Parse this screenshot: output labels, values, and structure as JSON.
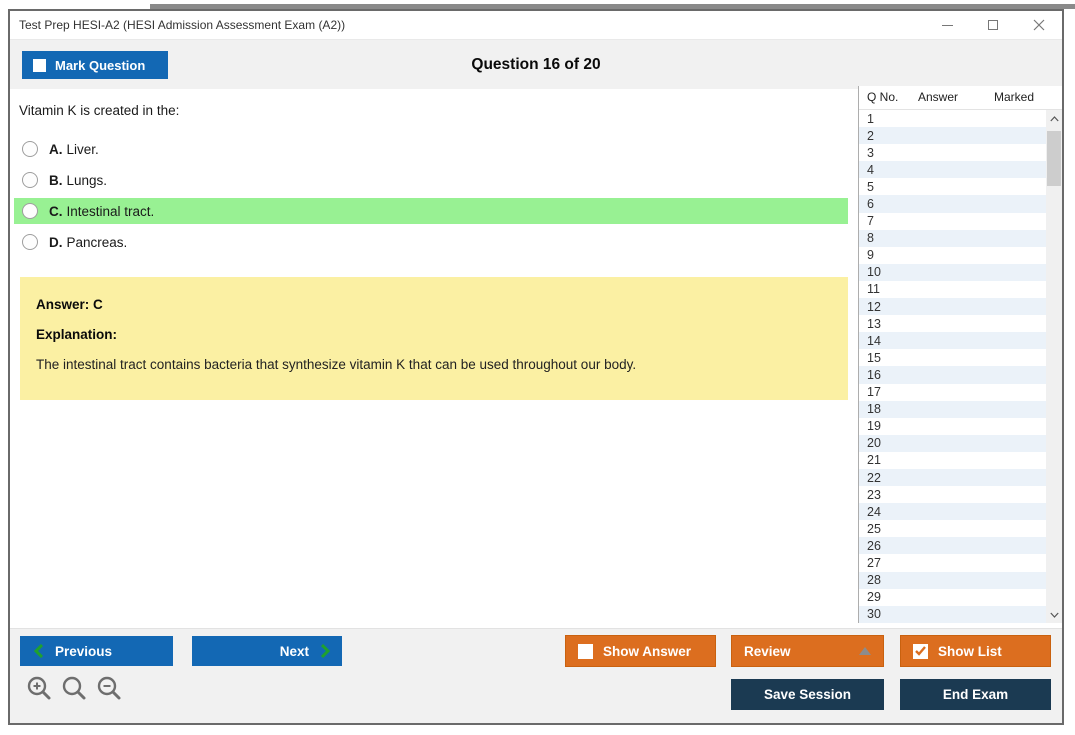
{
  "window": {
    "title": "Test Prep HESI-A2 (HESI Admission Assessment Exam (A2))"
  },
  "header": {
    "mark_question_label": "Mark Question",
    "question_counter": "Question 16 of 20"
  },
  "question": {
    "text": "Vitamin K is created in the:",
    "options": [
      {
        "letter": "A.",
        "text": "Liver.",
        "highlighted": false
      },
      {
        "letter": "B.",
        "text": "Lungs.",
        "highlighted": false
      },
      {
        "letter": "C.",
        "text": "Intestinal tract.",
        "highlighted": true
      },
      {
        "letter": "D.",
        "text": "Pancreas.",
        "highlighted": false
      }
    ]
  },
  "answer_panel": {
    "answer_label": "Answer: C",
    "explanation_label": "Explanation:",
    "explanation_text": "The intestinal tract contains bacteria that synthesize vitamin K that can be used throughout our body."
  },
  "question_list": {
    "columns": {
      "qno": "Q No.",
      "answer": "Answer",
      "marked": "Marked"
    },
    "row_numbers": [
      "1",
      "2",
      "3",
      "4",
      "5",
      "6",
      "7",
      "8",
      "9",
      "10",
      "11",
      "12",
      "13",
      "14",
      "15",
      "16",
      "17",
      "18",
      "19",
      "20",
      "21",
      "22",
      "23",
      "24",
      "25",
      "26",
      "27",
      "28",
      "29",
      "30"
    ]
  },
  "footer": {
    "previous_label": "Previous",
    "next_label": "Next",
    "show_answer_label": "Show Answer",
    "review_label": "Review",
    "show_list_label": "Show List",
    "save_session_label": "Save Session",
    "end_exam_label": "End Exam"
  },
  "icons": {
    "titlebar": [
      "minimize-icon",
      "maximize-icon",
      "close-icon"
    ],
    "footer": [
      "chevron-left-icon",
      "chevron-right-icon",
      "zoom-in-icon",
      "zoom-icon",
      "zoom-out-icon",
      "triangle-up-icon"
    ],
    "scrollbar": [
      "chevron-up-icon",
      "chevron-down-icon"
    ]
  },
  "colors": {
    "primary_blue": "#1368b4",
    "accent_orange": "#dc6e1f",
    "navy": "#1b3a52",
    "highlight_green": "#98f193",
    "answer_yellow": "#fbf0a3",
    "row_alt_blue": "#ebf2f9",
    "chevron_green": "#1fa12e",
    "bar_gray": "#f1f1f1"
  }
}
